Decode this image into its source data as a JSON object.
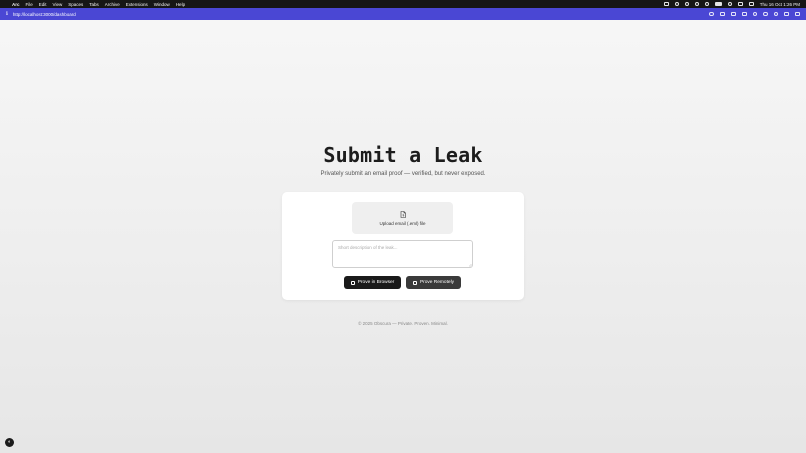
{
  "menubar": {
    "apple": "",
    "app_name": "Arc",
    "menus": [
      "File",
      "Edit",
      "View",
      "Spaces",
      "Tabs",
      "Archive",
      "Extensions",
      "Window",
      "Help"
    ],
    "clock": "Thu 16 Oct  1:26 PM"
  },
  "browser": {
    "url": "http://localhost:3000/dashboard",
    "accent": "#4a47d4"
  },
  "page": {
    "title": "Submit a Leak",
    "subtitle": "Privately submit an email proof — verified, but never exposed.",
    "upload_label": "Upload email (.eml) file",
    "description_placeholder": "Short description of the leak...",
    "prove_browser_label": "Prove in Browser",
    "prove_remote_label": "Prove Remotely",
    "footer": "© 2025 Obscura — Private. Proven. Minimal."
  }
}
